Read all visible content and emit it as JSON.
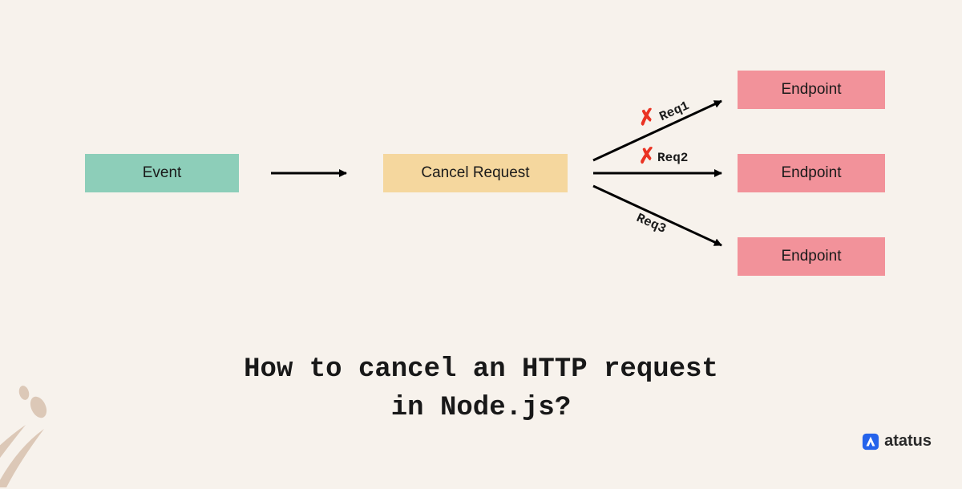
{
  "event_label": "Event",
  "cancel_label": "Cancel Request",
  "endpoints": {
    "ep1": "Endpoint",
    "ep2": "Endpoint",
    "ep3": "Endpoint"
  },
  "requests": {
    "req1": "Req1",
    "req2": "Req2",
    "req3": "Req3"
  },
  "x_marks": {
    "x1": "✗",
    "x2": "✗"
  },
  "title_line1": "How to cancel an HTTP request",
  "title_line2": "in Node.js?",
  "brand": "atatus",
  "colors": {
    "bg": "#f7f2ec",
    "event": "#8dceb9",
    "cancel": "#f5d79e",
    "endpoint": "#f2929a",
    "arrow": "#000000",
    "cross": "#ea3323",
    "decor": "#dcc8b7",
    "brand_icon": "#2563eb"
  },
  "chart_data": {
    "type": "diagram",
    "title": "How to cancel an HTTP request in Node.js?",
    "nodes": [
      {
        "id": "event",
        "label": "Event",
        "color": "#8dceb9"
      },
      {
        "id": "cancel",
        "label": "Cancel Request",
        "color": "#f5d79e"
      },
      {
        "id": "ep1",
        "label": "Endpoint",
        "color": "#f2929a"
      },
      {
        "id": "ep2",
        "label": "Endpoint",
        "color": "#f2929a"
      },
      {
        "id": "ep3",
        "label": "Endpoint",
        "color": "#f2929a"
      }
    ],
    "edges": [
      {
        "from": "event",
        "to": "cancel",
        "label": ""
      },
      {
        "from": "cancel",
        "to": "ep1",
        "label": "Req1",
        "cancelled": true
      },
      {
        "from": "cancel",
        "to": "ep2",
        "label": "Req2",
        "cancelled": true
      },
      {
        "from": "cancel",
        "to": "ep3",
        "label": "Req3",
        "cancelled": false
      }
    ]
  }
}
